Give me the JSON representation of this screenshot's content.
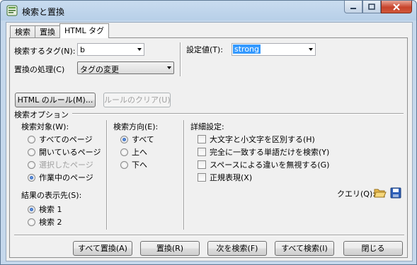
{
  "window": {
    "title": "検索と置換"
  },
  "tabs": [
    {
      "label": "検索"
    },
    {
      "label": "置換"
    },
    {
      "label": "HTML タグ"
    }
  ],
  "search_tag": {
    "label": "検索するタグ(N):",
    "value": "b"
  },
  "replace_action": {
    "label": "置換の処理(C)",
    "value": "タグの変更"
  },
  "setting_value": {
    "label": "設定値(T):",
    "value": "strong"
  },
  "html_rules_button": "HTML のルール(M)...",
  "clear_rules_button": "ルールのクリア(U)",
  "search_options": {
    "title": "検索オプション",
    "target": {
      "label": "検索対象(W):",
      "options": [
        "すべてのページ",
        "開いているページ",
        "選択したページ",
        "作業中のページ"
      ],
      "selected_index": 3,
      "disabled_index": 2
    },
    "direction": {
      "label": "検索方向(E):",
      "options": [
        "すべて",
        "上へ",
        "下へ"
      ],
      "selected_index": 0
    },
    "results": {
      "label": "結果の表示先(S):",
      "options": [
        "検索 1",
        "検索 2"
      ],
      "selected_index": 0
    },
    "advanced": {
      "label": "詳細設定:",
      "checkboxes": [
        "大文字と小文字を区別する(H)",
        "完全に一致する単語だけを検索(Y)",
        "スペースによる違いを無視する(G)",
        "正規表現(X)"
      ]
    },
    "query_label": "クエリ(Q):"
  },
  "buttons": {
    "replace_all": "すべて置換(A)",
    "replace": "置換(R)",
    "find_next": "次を検索(F)",
    "find_all": "すべて検索(I)",
    "close": "閉じる"
  }
}
